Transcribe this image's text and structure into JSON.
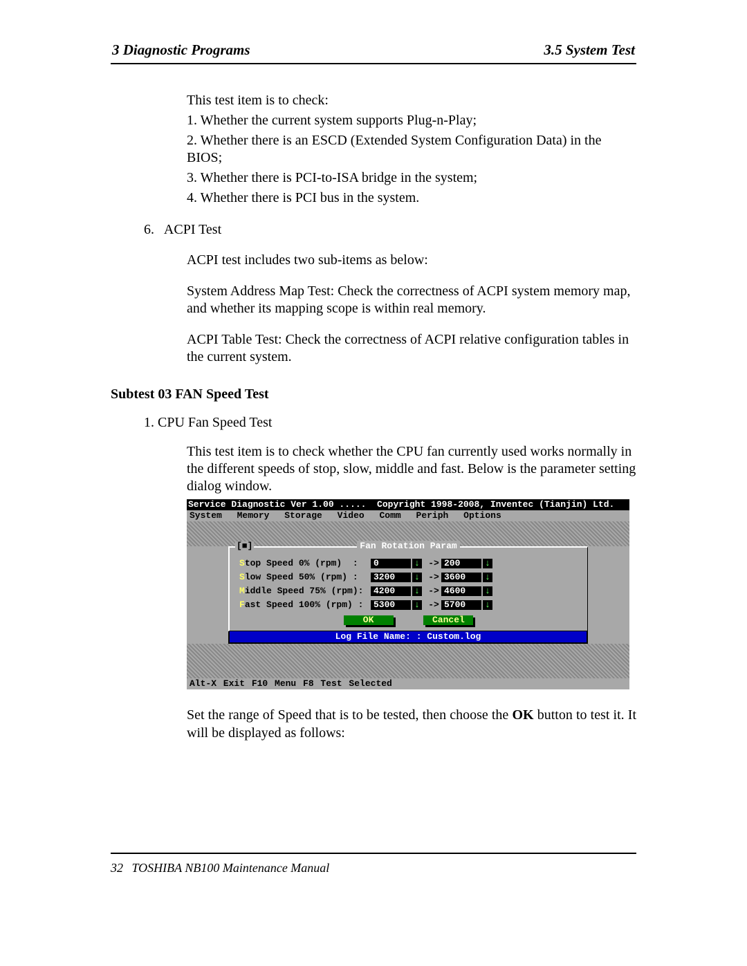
{
  "header": {
    "left": "3  Diagnostic Programs",
    "right": "3.5 System Test"
  },
  "intro": {
    "lead": "This test item is to check:",
    "items": [
      "1.   Whether the current system supports Plug-n-Play;",
      "2.   Whether there is an ESCD (Extended System Configuration Data) in the BIOS;",
      "3.   Whether there is PCI-to-ISA bridge in the system;",
      "4.   Whether there is PCI bus in the system."
    ]
  },
  "item6": {
    "num": "6.",
    "title": "ACPI Test",
    "p1": "ACPI test includes two sub-items as below:",
    "p2": "System Address Map Test: Check the correctness of ACPI system memory map, and whether its mapping scope is within real memory.",
    "p3": "ACPI Table Test: Check the correctness of ACPI relative configuration tables in the current system."
  },
  "subtest": {
    "heading": "Subtest 03  FAN Speed Test",
    "sub1": "1. CPU Fan Speed Test",
    "para": "This test item is to check whether the CPU fan currently used works normally in the different speeds of stop, slow, middle and fast. Below is the parameter setting dialog window."
  },
  "dos": {
    "title": "Service Diagnostic Ver 1.00 .....  Copyright 1998-2008, Inventec (Tianjin) Ltd.",
    "menus": [
      "System",
      "Memory",
      "Storage",
      "Video",
      "Comm",
      "Periph",
      "Options"
    ],
    "dialog_title": "Fan Rotation Param",
    "close": "[■]",
    "rows": [
      {
        "hot": "S",
        "rest": "top Speed 0% (rpm)  :",
        "from": "0",
        "to": "200"
      },
      {
        "hot": "S",
        "rest": "low Speed 50% (rpm) :",
        "from": "3200",
        "to": "3600"
      },
      {
        "hot": "M",
        "rest": "iddle Speed 75% (rpm):",
        "from": "4200",
        "to": "4600"
      },
      {
        "hot": "F",
        "rest": "ast Speed 100% (rpm) :",
        "from": "5300",
        "to": "5700"
      }
    ],
    "arrow_glyph": "↓",
    "range_arrow": "->",
    "ok": "OK",
    "cancel": "Cancel",
    "log": "Log File Name: : Custom.log",
    "footer": "Alt-X Exit  F10 Menu  F8 Test Selected"
  },
  "after": {
    "p1a": "Set the range of Speed that is to be tested, then choose the ",
    "p1b": "OK",
    "p1c": " button to test it. It will be displayed as follows:"
  },
  "footer": {
    "page": "32",
    "title": "TOSHIBA NB100 Maintenance Manual"
  }
}
